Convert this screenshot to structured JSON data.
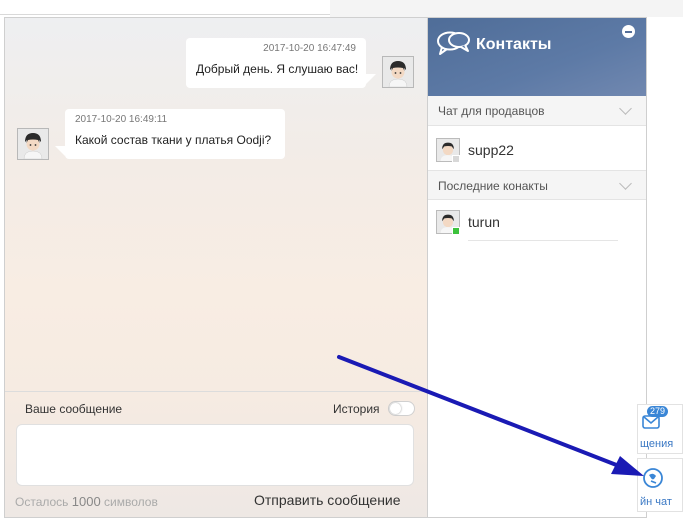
{
  "messages": [
    {
      "timestamp": "2017-10-20 16:47:49",
      "text": "Добрый день. Я слушаю вас!",
      "side": "right"
    },
    {
      "timestamp": "2017-10-20 16:49:11",
      "text": "Какой состав ткани у платья Oodji?",
      "side": "left"
    }
  ],
  "composer": {
    "label": "Ваше сообщение",
    "history_label": "История",
    "input_value": "",
    "remaining_prefix": "Осталось",
    "remaining_count": "1000",
    "remaining_suffix": "символов",
    "send_label": "Отправить сообщение"
  },
  "contacts": {
    "title": "Контакты",
    "sections": [
      {
        "label": "Чат для продавцов",
        "items": [
          {
            "name": "supp22",
            "status_color": "#d8d8d8"
          }
        ]
      },
      {
        "label": "Последние конакты",
        "items": [
          {
            "name": "turun",
            "status_color": "#3cc23c"
          }
        ]
      }
    ]
  },
  "side_tabs": {
    "messages_badge": "279",
    "messages_label": "щения",
    "chat_label": "йн чат"
  },
  "colors": {
    "header": "#5872a0",
    "arrow": "#1a1ab4",
    "accent": "#3a86d6"
  },
  "icons": [
    "chat-bubbles-icon",
    "minimize-icon",
    "chevron-down-icon",
    "envelope-icon",
    "online-chat-icon"
  ]
}
